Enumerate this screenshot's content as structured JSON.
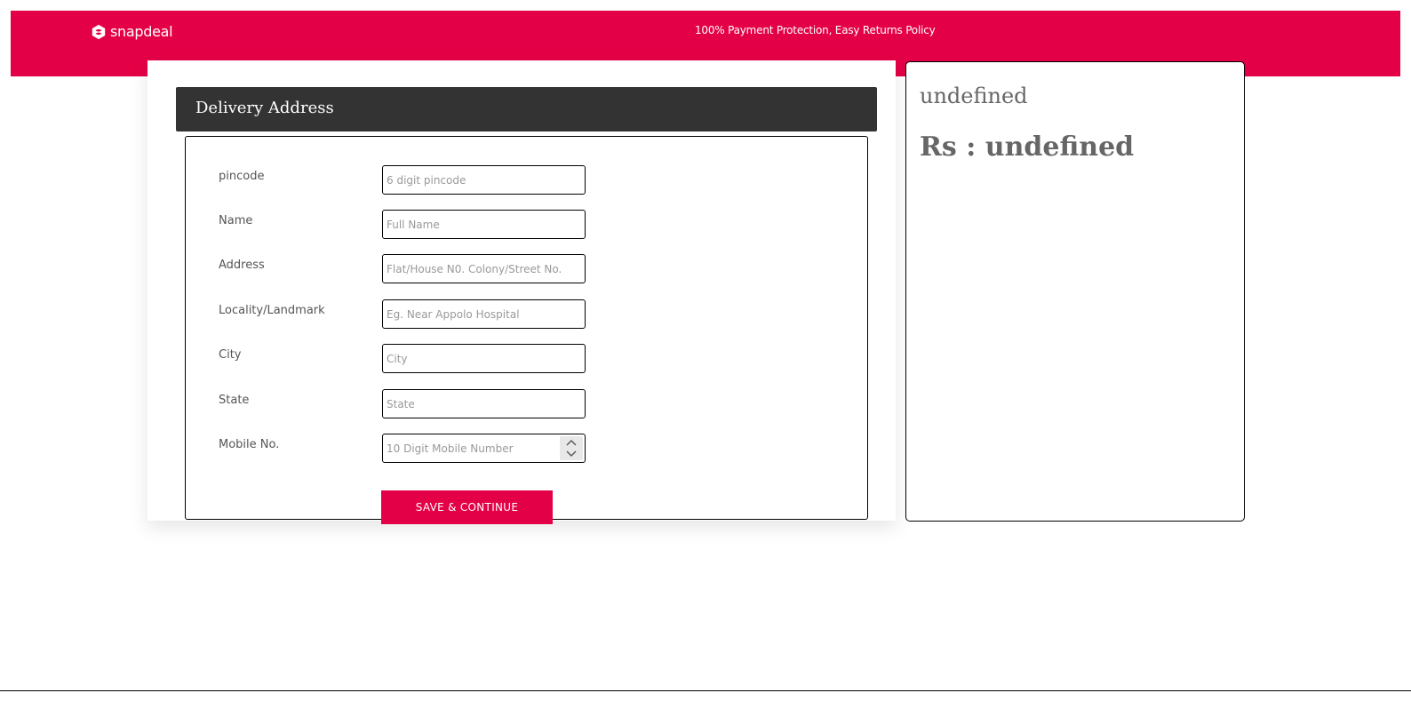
{
  "header": {
    "brand": "snapdeal",
    "tagline": "100% Payment Protection, Easy Returns Policy"
  },
  "delivery": {
    "title": "Delivery Address",
    "fields": [
      {
        "label": "pincode",
        "placeholder": "6 digit pincode",
        "value": ""
      },
      {
        "label": "Name",
        "placeholder": "Full Name",
        "value": ""
      },
      {
        "label": "Address",
        "placeholder": "Flat/House N0. Colony/Street No.",
        "value": ""
      },
      {
        "label": "Locality/Landmark",
        "placeholder": "Eg. Near Appolo Hospital",
        "value": ""
      },
      {
        "label": "City",
        "placeholder": "City",
        "value": ""
      },
      {
        "label": "State",
        "placeholder": "State",
        "value": ""
      },
      {
        "label": "Mobile No.",
        "placeholder": "10 Digit Mobile Number",
        "value": ""
      }
    ],
    "save_button": "SAVE & CONTINUE"
  },
  "summary": {
    "product_name": "undefined",
    "price_label": "Rs : undefined"
  },
  "colors": {
    "brand": "#e40046",
    "header_dark": "#333333"
  }
}
